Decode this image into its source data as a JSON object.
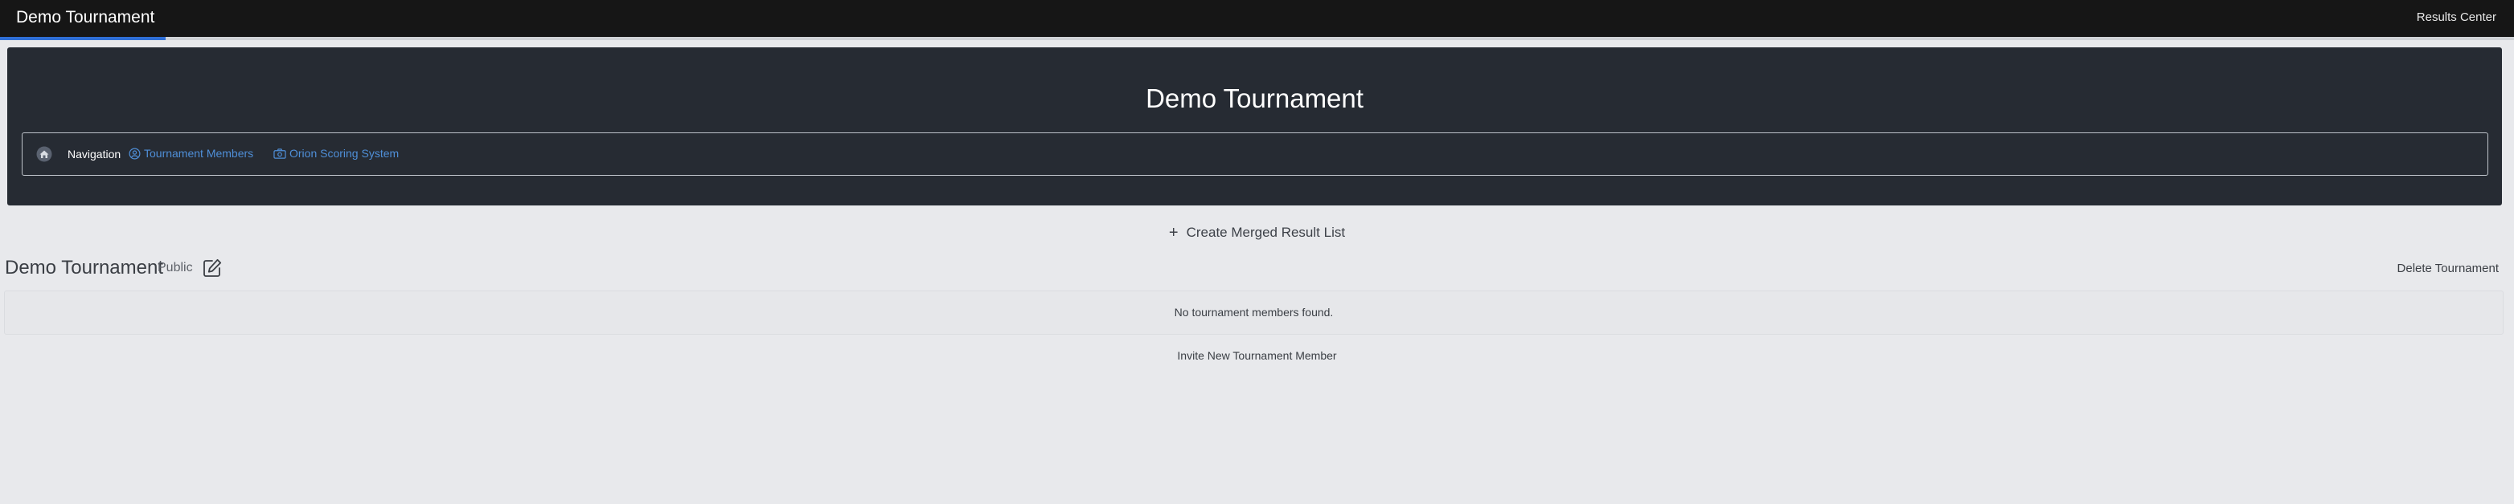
{
  "header": {
    "app_title": "Demo Tournament",
    "results_center_label": "Results Center",
    "progress_fraction": 0.066,
    "accent_color": "#2f6fd6"
  },
  "hero": {
    "title": "Demo Tournament",
    "navigation": {
      "home_icon": "home-icon",
      "label": "Navigation",
      "links": [
        {
          "label": "Tournament Members",
          "icon": "user-circle-icon"
        },
        {
          "label": "Orion Scoring System",
          "icon": "scoring-icon"
        }
      ],
      "link_color": "#4f8fd8"
    }
  },
  "actions": {
    "create_merged_label": "Create Merged Result List",
    "create_icon": "plus-icon"
  },
  "tournament": {
    "name": "Demo Tournament",
    "visibility": "Public",
    "edit_icon": "edit-icon",
    "delete_label": "Delete Tournament",
    "members_empty_text": "No tournament members found.",
    "invite_label": "Invite New Tournament Member"
  }
}
